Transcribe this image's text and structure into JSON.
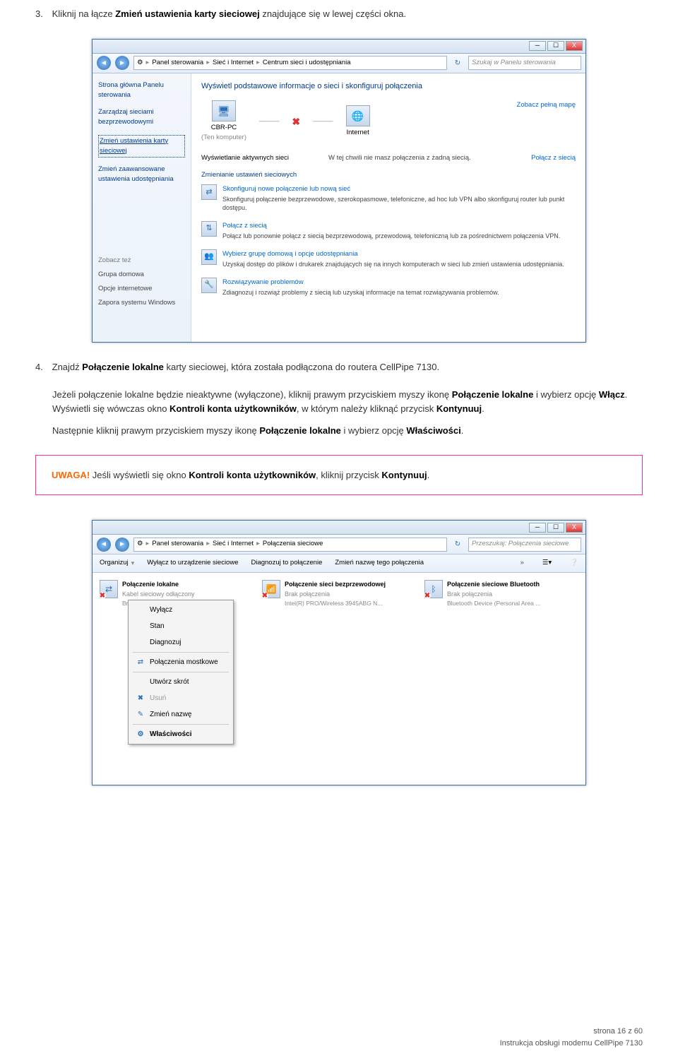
{
  "step3": {
    "num": "3.",
    "text_before": "Kliknij na łącze ",
    "bold": "Zmień ustawienia karty sieciowej",
    "text_after": " znajdujące się w lewej części okna."
  },
  "win1": {
    "breadcrumb": [
      "Panel sterowania",
      "Sieć i Internet",
      "Centrum sieci i udostępniania"
    ],
    "search_placeholder": "Szukaj w Panelu sterowania",
    "sidebar": {
      "tasks": [
        "Strona główna Panelu sterowania",
        "Zarządzaj sieciami bezprzewodowymi",
        "Zmień ustawienia karty sieciowej",
        "Zmień zaawansowane ustawienia udostępniania"
      ],
      "seealso_title": "Zobacz też",
      "seealso": [
        "Grupa domowa",
        "Opcje internetowe",
        "Zapora systemu Windows"
      ]
    },
    "main": {
      "heading": "Wyświetl podstawowe informacje o sieci i skonfiguruj połączenia",
      "map_link": "Zobacz pełną mapę",
      "node1_name": "CBR-PC",
      "node1_sub": "(Ten komputer)",
      "node2_name": "Internet",
      "active_lbl": "Wyświetlanie aktywnych sieci",
      "active_val": "W tej chwili nie masz połączenia z żadną siecią.",
      "active_link": "Połącz z siecią",
      "change_title": "Zmienianie ustawień sieciowych",
      "tasks": [
        {
          "title": "Skonfiguruj nowe połączenie lub nową sieć",
          "desc": "Skonfiguruj połączenie bezprzewodowe, szerokopasmowe, telefoniczne, ad hoc lub VPN albo skonfiguruj router lub punkt dostępu."
        },
        {
          "title": "Połącz z siecią",
          "desc": "Połącz lub ponownie połącz z siecią bezprzewodową, przewodową, telefoniczną lub za pośrednictwem połączenia VPN."
        },
        {
          "title": "Wybierz grupę domową i opcje udostępniania",
          "desc": "Uzyskaj dostęp do plików i drukarek znajdujących się na innych komputerach w sieci lub zmień ustawienia udostępniania."
        },
        {
          "title": "Rozwiązywanie problemów",
          "desc": "Zdiagnozuj i rozwiąż problemy z siecią lub uzyskaj informacje na temat rozwiązywania problemów."
        }
      ]
    }
  },
  "step4": {
    "num": "4.",
    "s1_a": "Znajdź ",
    "s1_b": "Połączenie lokalne",
    "s1_c": " karty sieciowej, która została podłączona do routera CellPipe 7130.",
    "s2_a": "Jeżeli połączenie lokalne będzie nieaktywne (wyłączone), kliknij prawym przyciskiem myszy ikonę ",
    "s2_b": "Połączenie lokalne",
    "s2_c": " i wybierz opcję ",
    "s2_d": "Włącz",
    "s2_e": ". Wyświetli się wówczas okno ",
    "s2_f": "Kontroli konta użytkowników",
    "s2_g": ", w którym należy kliknąć przycisk ",
    "s2_h": "Kontynuuj",
    "s2_i": ".",
    "s3_a": "Następnie kliknij prawym przyciskiem myszy ikonę ",
    "s3_b": "Połączenie lokalne",
    "s3_c": " i wybierz opcję ",
    "s3_d": "Właściwości",
    "s3_e": "."
  },
  "alert": {
    "uwaga": "UWAGA!",
    "a": " Jeśli wyświetli się okno ",
    "b": "Kontroli konta użytkowników",
    "c": ", kliknij przycisk ",
    "d": "Kontynuuj",
    "e": "."
  },
  "win2": {
    "breadcrumb": [
      "Panel sterowania",
      "Sieć i Internet",
      "Połączenia sieciowe"
    ],
    "search_placeholder": "Przeszukaj: Połączenia sieciowe",
    "toolbar": [
      "Organizuj",
      "Wyłącz to urządzenie sieciowe",
      "Diagnozuj to połączenie",
      "Zmień nazwę tego połączenia"
    ],
    "connections": [
      {
        "title": "Połączenie lokalne",
        "sub1": "Kabel sieciowy odłączony",
        "sub2": "Broa..."
      },
      {
        "title": "Połączenie sieci bezprzewodowej",
        "sub1": "Brak połączenia",
        "sub2": "Intel(R) PRO/Wireless 3945ABG N..."
      },
      {
        "title": "Połączenie sieciowe Bluetooth",
        "sub1": "Brak połączenia",
        "sub2": "Bluetooth Device (Personal Area ..."
      }
    ],
    "context_menu": [
      "Wyłącz",
      "Stan",
      "Diagnozuj",
      "Połączenia mostkowe",
      "Utwórz skrót",
      "Usuń",
      "Zmień nazwę",
      "Właściwości"
    ]
  },
  "footer": {
    "page": "strona 16 z 60",
    "doc": "Instrukcja obsługi modemu CellPipe 7130"
  }
}
